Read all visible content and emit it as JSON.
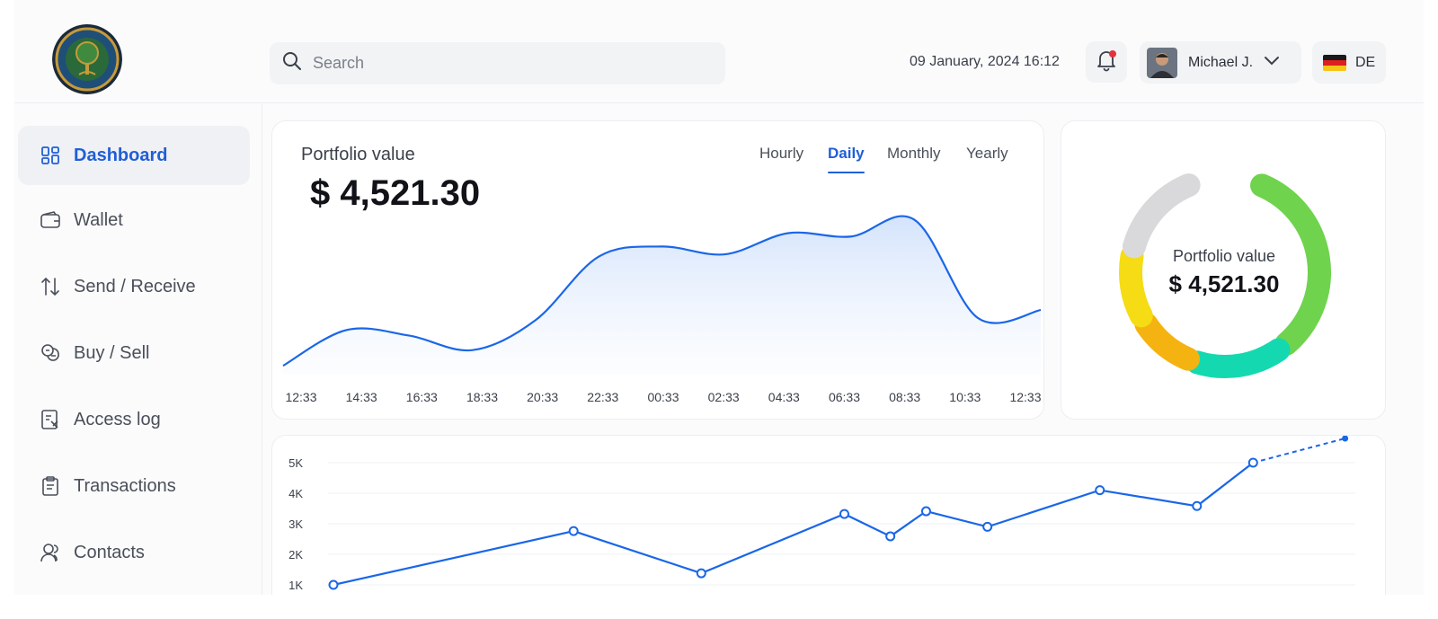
{
  "header": {
    "search_placeholder": "Search",
    "datetime": "09 January, 2024 16:12",
    "user_name": "Michael J.",
    "language": "DE",
    "notification_dot_color": "#e5323a"
  },
  "sidebar": {
    "items": [
      {
        "label": "Dashboard",
        "icon": "grid-icon",
        "active": true
      },
      {
        "label": "Wallet",
        "icon": "wallet-icon",
        "active": false
      },
      {
        "label": "Send / Receive",
        "icon": "arrows-up-down-icon",
        "active": false
      },
      {
        "label": "Buy / Sell",
        "icon": "coins-icon",
        "active": false
      },
      {
        "label": "Access log",
        "icon": "log-icon",
        "active": false
      },
      {
        "label": "Transactions",
        "icon": "clipboard-icon",
        "active": false
      },
      {
        "label": "Contacts",
        "icon": "contacts-icon",
        "active": false
      }
    ]
  },
  "portfolio": {
    "title": "Portfolio value",
    "value": "$ 4,521.30",
    "tabs": [
      "Hourly",
      "Daily",
      "Monthly",
      "Yearly"
    ],
    "active_tab": "Daily"
  },
  "donut": {
    "label": "Portfolio value",
    "value": "$ 4,521.30"
  },
  "colors": {
    "accent": "#1f5fd6",
    "line": "#1a66e8",
    "donut_green": "#6fd34e",
    "donut_teal": "#14d9b0",
    "donut_orange": "#f5b311",
    "donut_yellow": "#f5dc14",
    "donut_gray": "#d9d9db"
  },
  "chart_data": [
    {
      "type": "area",
      "x": [
        "12:33",
        "14:33",
        "16:33",
        "18:33",
        "20:33",
        "22:33",
        "00:33",
        "02:33",
        "04:33",
        "06:33",
        "08:33",
        "10:33",
        "12:33"
      ],
      "values": [
        4.0,
        20.0,
        17.5,
        11.0,
        24.5,
        53.0,
        57.5,
        54.0,
        63.5,
        62.0,
        69.5,
        25.5,
        29.0
      ],
      "title": "Portfolio value"
    },
    {
      "type": "pie",
      "labels": [],
      "values": [
        34,
        16,
        11,
        12,
        16,
        11
      ],
      "colors": [
        "#6fd34e",
        "#14d9b0",
        "#f5b311",
        "#f5dc14",
        "#d9d9db",
        "#ffffff"
      ]
    },
    {
      "type": "line",
      "yticks": [
        "5K",
        "4K",
        "3K",
        "2K",
        "1K"
      ],
      "ylim": [
        1000,
        5000
      ],
      "points": [
        {
          "x": 0.0,
          "y": 1000
        },
        {
          "x": 0.235,
          "y": 2760
        },
        {
          "x": 0.36,
          "y": 1380
        },
        {
          "x": 0.5,
          "y": 3320
        },
        {
          "x": 0.545,
          "y": 2590
        },
        {
          "x": 0.58,
          "y": 3410
        },
        {
          "x": 0.64,
          "y": 2900
        },
        {
          "x": 0.75,
          "y": 4100
        },
        {
          "x": 0.845,
          "y": 3580
        },
        {
          "x": 0.9,
          "y": 5000
        }
      ],
      "projected": {
        "x": 0.99,
        "y": 5800
      }
    }
  ]
}
